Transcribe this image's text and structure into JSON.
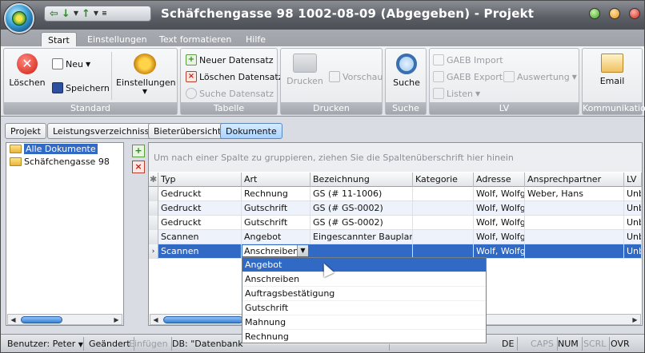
{
  "window": {
    "title": "Schäfchengasse 98 1002-08-09 (Abgegeben) - Projekt"
  },
  "ribbon_tabs": [
    "Start",
    "Einstellungen",
    "Text formatieren",
    "Hilfe"
  ],
  "groups": {
    "standard": {
      "label": "Standard",
      "loeschen": "Löschen",
      "neu": "Neu",
      "speichern": "Speichern",
      "einstellungen": "Einstellungen"
    },
    "tabelle": {
      "label": "Tabelle",
      "neuer_datensatz": "Neuer Datensatz",
      "loeschen_datensatz": "Löschen Datensatz",
      "suche_datensatz": "Suche Datensatz"
    },
    "drucken": {
      "label": "Drucken",
      "drucken": "Drucken",
      "vorschau": "Vorschau"
    },
    "suche": {
      "label": "Suche",
      "suche": "Suche"
    },
    "lv": {
      "label": "LV",
      "gaeb_import": "GAEB Import",
      "gaeb_export": "GAEB Export",
      "auswertung": "Auswertung",
      "listen": "Listen"
    },
    "kommunikation": {
      "label": "Kommunikation",
      "email": "Email"
    }
  },
  "page_tabs": [
    "Projekt",
    "Leistungsverzeichnisse",
    "Bieterübersicht",
    "Dokumente"
  ],
  "tree": {
    "items": [
      "Alle Dokumente",
      "Schäfchengasse 98"
    ]
  },
  "grid": {
    "group_hint": "Um nach einer Spalte zu gruppieren, ziehen Sie die Spaltenüberschrift hier hinein",
    "columns": [
      "Typ",
      "Art",
      "Bezeichnung",
      "Kategorie",
      "Adresse",
      "Ansprechpartner",
      "LV"
    ],
    "rows": [
      [
        "Gedruckt",
        "Rechnung",
        "GS (# 11-1006)",
        "",
        "Wolf, Wolfga",
        "Weber, Hans",
        "Unb"
      ],
      [
        "Gedruckt",
        "Gutschrift",
        "GS (# GS-0002)",
        "",
        "Wolf, Wolfga",
        "",
        "Unb"
      ],
      [
        "Gedruckt",
        "Gutschrift",
        "GS (# GS-0002)",
        "",
        "Wolf, Wolfga",
        "",
        "Unb"
      ],
      [
        "Scannen",
        "Angebot",
        "Eingescannter Bauplan",
        "",
        "Wolf, Wolfga",
        "",
        "Unb"
      ],
      [
        "Scannen",
        "Anschreiben",
        "",
        "",
        "Wolf, Wolfga",
        "",
        "Unb"
      ]
    ],
    "dropdown_options": [
      "Angebot",
      "Anschreiben",
      "Auftragsbestätigung",
      "Gutschrift",
      "Mahnung",
      "Rechnung"
    ]
  },
  "status": {
    "benutzer": "Benutzer: Peter",
    "geaendert": "Geändert",
    "einfuegen": "Einfügen",
    "db": "DB: \"Datenbank\"",
    "lang": "DE",
    "caps": "CAPS",
    "num": "NUM",
    "scrl": "SCRL",
    "ovr": "OVR"
  },
  "colors": {
    "selection": "#316ac5",
    "tab_active": "#a9d3ff"
  }
}
